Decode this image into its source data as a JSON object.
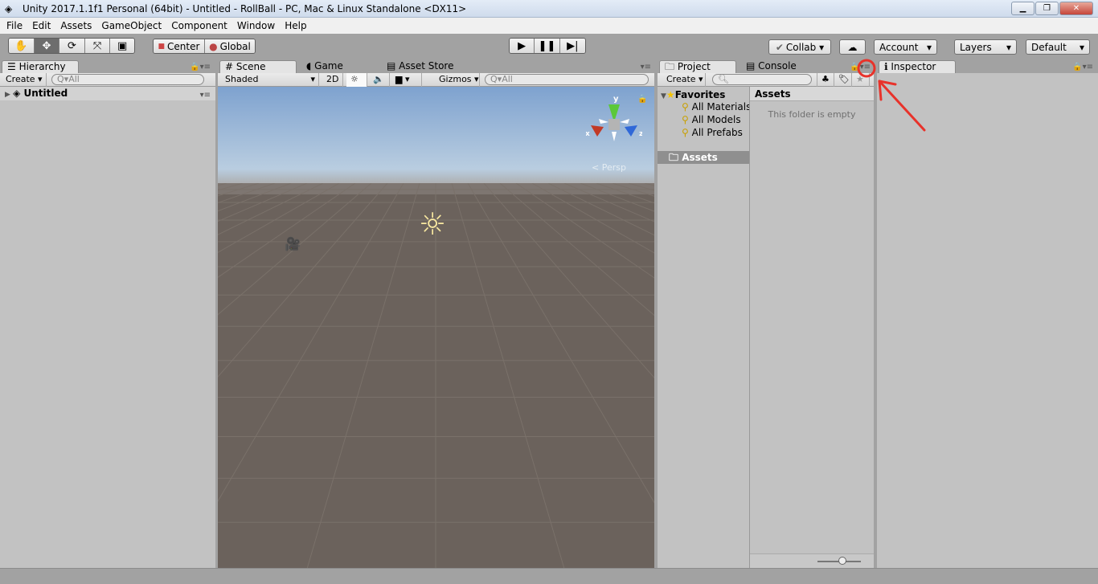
{
  "window": {
    "title": "Unity 2017.1.1f1 Personal (64bit) - Untitled - RollBall - PC, Mac & Linux Standalone <DX11>",
    "buttons": [
      "minimize",
      "restore",
      "close"
    ]
  },
  "menu": [
    "File",
    "Edit",
    "Assets",
    "GameObject",
    "Component",
    "Window",
    "Help"
  ],
  "toolbar": {
    "tools": [
      "hand-icon",
      "move-icon",
      "rotate-icon",
      "scale-icon",
      "rect-icon"
    ],
    "active_tool": "move",
    "pivot": "Center",
    "space": "Global",
    "collab": "Collab",
    "account": "Account",
    "layers": "Layers",
    "layout": "Default"
  },
  "hierarchy": {
    "tab": "Hierarchy",
    "create": "Create",
    "search_placeholder": "All",
    "scene": "Untitled"
  },
  "scene": {
    "tabs": [
      "Scene",
      "Game",
      "Asset Store"
    ],
    "shading": "Shaded",
    "mode_2d": "2D",
    "gizmos": "Gizmos",
    "search_placeholder": "All",
    "persp": "Persp",
    "axes": {
      "x": "x",
      "y": "y",
      "z": "z"
    }
  },
  "project": {
    "tabs": [
      "Project",
      "Console"
    ],
    "create": "Create",
    "favorites": "Favorites",
    "fav_items": [
      "All Materials",
      "All Models",
      "All Prefabs"
    ],
    "assets": "Assets",
    "header": "Assets",
    "empty": "This folder is empty"
  },
  "inspector": {
    "tab": "Inspector"
  },
  "colors": {
    "annotation": "#e8322a",
    "sky": "#9cb8d8",
    "ground": "#6b625c"
  }
}
